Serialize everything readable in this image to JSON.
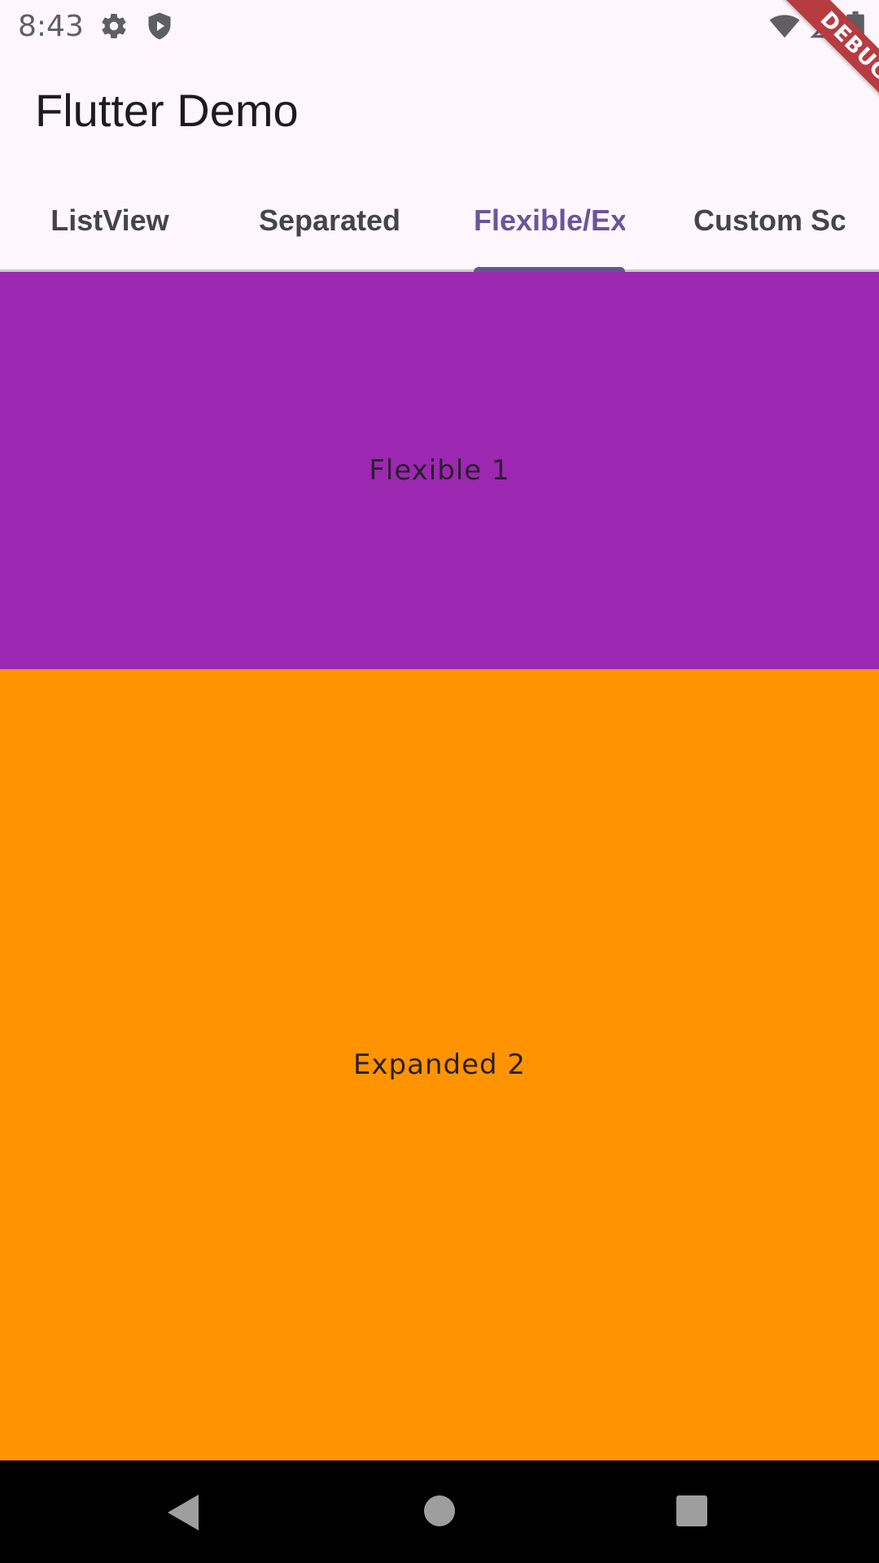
{
  "status_bar": {
    "time": "8:43",
    "icons": [
      "gear-icon",
      "shield-icon",
      "wifi-icon",
      "signal-icon",
      "battery-icon"
    ]
  },
  "debug_banner": {
    "label": "DEBUG"
  },
  "app_bar": {
    "title": "Flutter Demo"
  },
  "tabs": [
    {
      "label": "ListView",
      "selected": false
    },
    {
      "label": "Separated",
      "selected": false
    },
    {
      "label": "Flexible/Ex",
      "selected": true
    },
    {
      "label": "Custom Sc",
      "selected": false
    }
  ],
  "panels": {
    "flexible": {
      "label": "Flexible 1",
      "color": "#9c27b0"
    },
    "expanded": {
      "label": "Expanded 2",
      "color": "#ff9400"
    }
  },
  "nav_bar": {
    "icons": [
      "back-icon",
      "home-icon",
      "recents-icon"
    ]
  },
  "colors": {
    "accent": "#65558f",
    "background": "#fdf7fd"
  }
}
